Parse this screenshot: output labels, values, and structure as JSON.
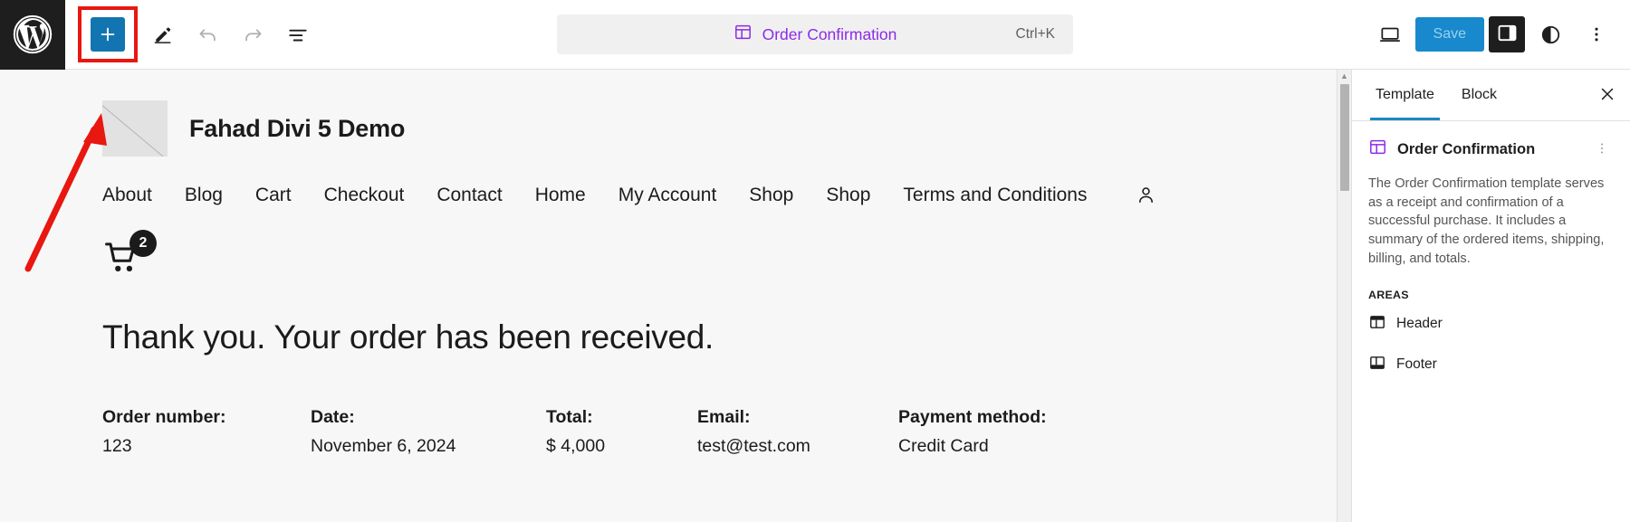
{
  "toolbar": {
    "wp_logo": "wordpress-logo",
    "add_block_label": "+",
    "edit_label": "edit-tool",
    "undo_label": "undo",
    "redo_label": "redo",
    "list_view_label": "list-view",
    "command_bar": {
      "title": "Order Confirmation",
      "shortcut": "Ctrl+K",
      "icon": "template-icon"
    },
    "view_device_label": "desktop-view",
    "save_label": "Save",
    "settings_toggle_label": "settings-sidebar",
    "styles_label": "styles",
    "options_label": "options"
  },
  "canvas": {
    "site_title": "Fahad Divi 5 Demo",
    "nav_items": [
      {
        "label": "About"
      },
      {
        "label": "Blog"
      },
      {
        "label": "Cart"
      },
      {
        "label": "Checkout"
      },
      {
        "label": "Contact"
      },
      {
        "label": "Home"
      },
      {
        "label": "My Account"
      },
      {
        "label": "Shop"
      },
      {
        "label": "Shop"
      },
      {
        "label": "Terms and Conditions"
      }
    ],
    "account_icon": "user-icon",
    "cart_icon": "cart-icon",
    "cart_count": "2",
    "heading": "Thank you. Your order has been received.",
    "order_fields": [
      {
        "label": "Order number:",
        "value": "123"
      },
      {
        "label": "Date:",
        "value": "November 6, 2024"
      },
      {
        "label": "Total:",
        "value": "$ 4,000"
      },
      {
        "label": "Email:",
        "value": "test@test.com"
      },
      {
        "label": "Payment method:",
        "value": "Credit Card"
      }
    ]
  },
  "sidebar": {
    "tabs": [
      {
        "label": "Template",
        "active": true
      },
      {
        "label": "Block",
        "active": false
      }
    ],
    "close_label": "close-sidebar",
    "template_title": "Order Confirmation",
    "template_icon": "template-icon",
    "template_menu_label": "template-actions",
    "description": "The Order Confirmation template serves as a receipt and confirmation of a successful purchase. It includes a summary of the ordered items, shipping, billing, and totals.",
    "areas_label": "AREAS",
    "areas": [
      {
        "label": "Header",
        "icon": "header-icon"
      },
      {
        "label": "Footer",
        "icon": "footer-icon"
      }
    ]
  },
  "colors": {
    "accent_blue": "#1275b1",
    "save_blue": "#1889cc",
    "purple": "#8c2ae8",
    "annotation_red": "#e8170f",
    "tab_active": "#1e87c4"
  }
}
